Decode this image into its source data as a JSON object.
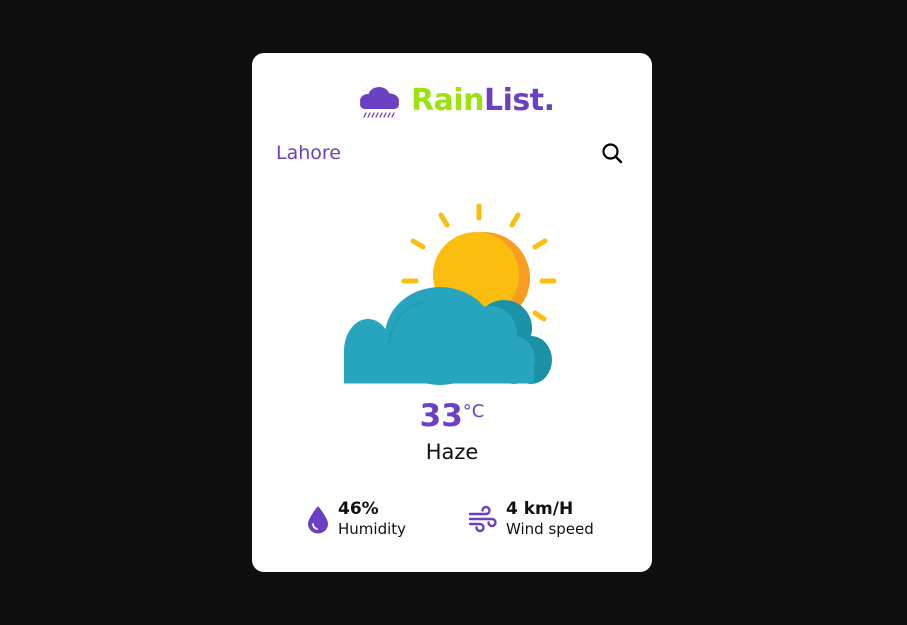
{
  "brand": {
    "name_part1": "Rain",
    "name_part2": "List.",
    "icon": "rain-cloud-icon",
    "colors": {
      "accent": "#6c40c2",
      "highlight": "#9be20f"
    }
  },
  "location": {
    "city": "Lahore",
    "search_icon": "search-icon"
  },
  "weather": {
    "temperature": "33",
    "unit": "°C",
    "condition": "Haze",
    "icon": "sun-behind-cloud-icon"
  },
  "stats": {
    "humidity": {
      "value": "46%",
      "label": "Humidity",
      "icon": "water-drop-icon"
    },
    "wind": {
      "value": "4 km/H",
      "label": "Wind speed",
      "icon": "wind-icon"
    }
  }
}
